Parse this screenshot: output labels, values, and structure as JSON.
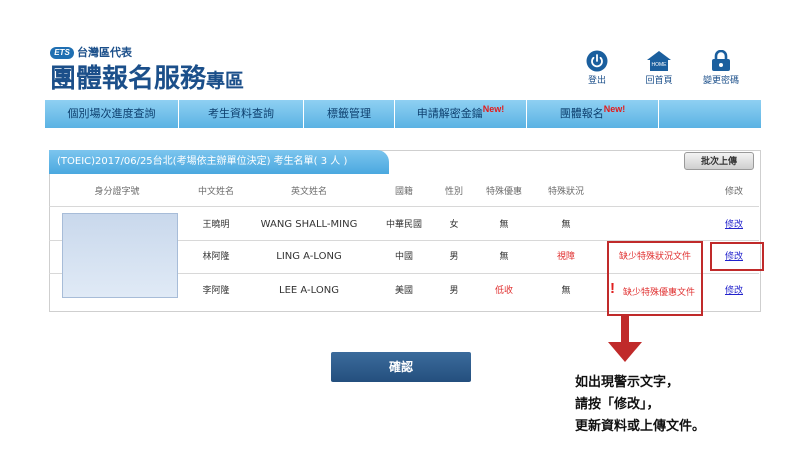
{
  "header": {
    "logo_mark": "ETS",
    "logo_sub": "台灣區代表",
    "title_main": "團體報名服務",
    "title_small": "專區",
    "buttons": [
      {
        "label": "登出",
        "icon": "power-icon"
      },
      {
        "label": "回首頁",
        "icon": "home-icon"
      },
      {
        "label": "變更密碼",
        "icon": "lock-icon"
      }
    ],
    "home_icon_text": "HOME"
  },
  "nav": {
    "items": [
      {
        "label": "個別場次進度查詢",
        "new": ""
      },
      {
        "label": "考生資料查詢",
        "new": ""
      },
      {
        "label": "標籤管理",
        "new": ""
      },
      {
        "label": "申請解密金鑰",
        "new": "New!"
      },
      {
        "label": "團體報名",
        "new": "New!"
      }
    ]
  },
  "panel": {
    "tab_title": "(TOEIC)2017/06/25台北(考場依主辦單位決定) 考生名單( 3 人 )",
    "upload_label": "批次上傳",
    "columns": [
      "身分證字號",
      "中文姓名",
      "英文姓名",
      "國籍",
      "性別",
      "特殊優惠",
      "特殊狀況",
      "",
      "修改"
    ],
    "rows": [
      {
        "id": "",
        "cname": "王曉明",
        "ename": "WANG SHALL-MING",
        "nation": "中華民國",
        "gender": "女",
        "discount": "無",
        "status": "無",
        "warning": "",
        "edit": "修改"
      },
      {
        "id": "",
        "cname": "林阿隆",
        "ename": "LING A-LONG",
        "nation": "中國",
        "gender": "男",
        "discount": "無",
        "status": "視障",
        "warning": "缺少特殊狀況文件",
        "edit": "修改"
      },
      {
        "id": "",
        "cname": "李阿隆",
        "ename": "LEE A-LONG",
        "nation": "美國",
        "gender": "男",
        "discount": "低收",
        "status": "無",
        "warning": "缺少特殊優惠文件",
        "edit": "修改"
      }
    ]
  },
  "confirm_label": "確認",
  "instructions": [
    "如出現警示文字，",
    "請按「修改」，",
    "更新資料或上傳文件。"
  ],
  "colors": {
    "accent": "#1b4f8a",
    "nav": "#5ab2e3",
    "warning": "#c02a2a"
  }
}
